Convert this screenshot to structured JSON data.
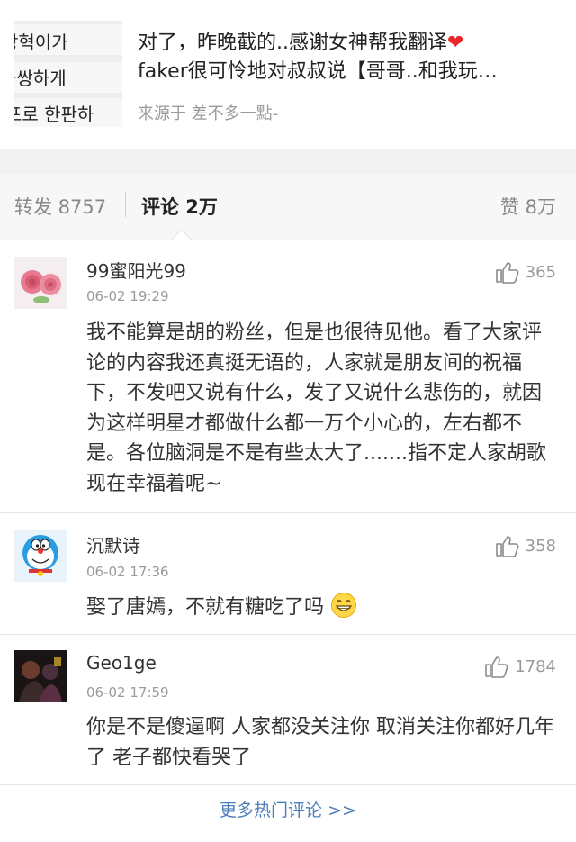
{
  "post": {
    "thumbnail_lines": [
      "강혁이가",
      "불쌍하게",
      "포로 한판하"
    ],
    "title_line1": "对了，昨晚截的..感谢女神帮我翻译",
    "heart": "❤",
    "title_line2": "faker很可怜地对叔叔说【哥哥..和我玩…",
    "source": "来源于 差不多一點-"
  },
  "tabs": {
    "repost": "转发 8757",
    "comment": "评论 2万",
    "like": "赞 8万"
  },
  "comments": [
    {
      "user": "99蜜阳光99",
      "time": "06-02 19:29",
      "likes": "365",
      "avatar_icon": "rose-avatar",
      "text": "我不能算是胡的粉丝，但是也很待见他。看了大家评论的内容我还真挺无语的，人家就是朋友间的祝福下，不发吧又说有什么，发了又说什么悲伤的，就因为这样明星才都做什么都一万个小心的，左右都不是。各位脑洞是不是有些太大了.......指不定人家胡歌现在幸福着呢~"
    },
    {
      "user": "沉默诗",
      "time": "06-02 17:36",
      "likes": "358",
      "avatar_icon": "doraemon-avatar",
      "text": "娶了唐嫣，不就有糖吃了吗"
    },
    {
      "user": "Geo1ge",
      "time": "06-02 17:59",
      "likes": "1784",
      "avatar_icon": "dark-photo-avatar",
      "text": "你是不是傻逼啊 人家都没关注你 取消关注你都好几年了 老子都快看哭了"
    }
  ],
  "more_link": "更多热门评论 >>",
  "colors": {
    "link": "#4c7fb9",
    "muted": "#9a9a9a",
    "heart": "#e8262b",
    "divider": "#e2e2e2"
  }
}
